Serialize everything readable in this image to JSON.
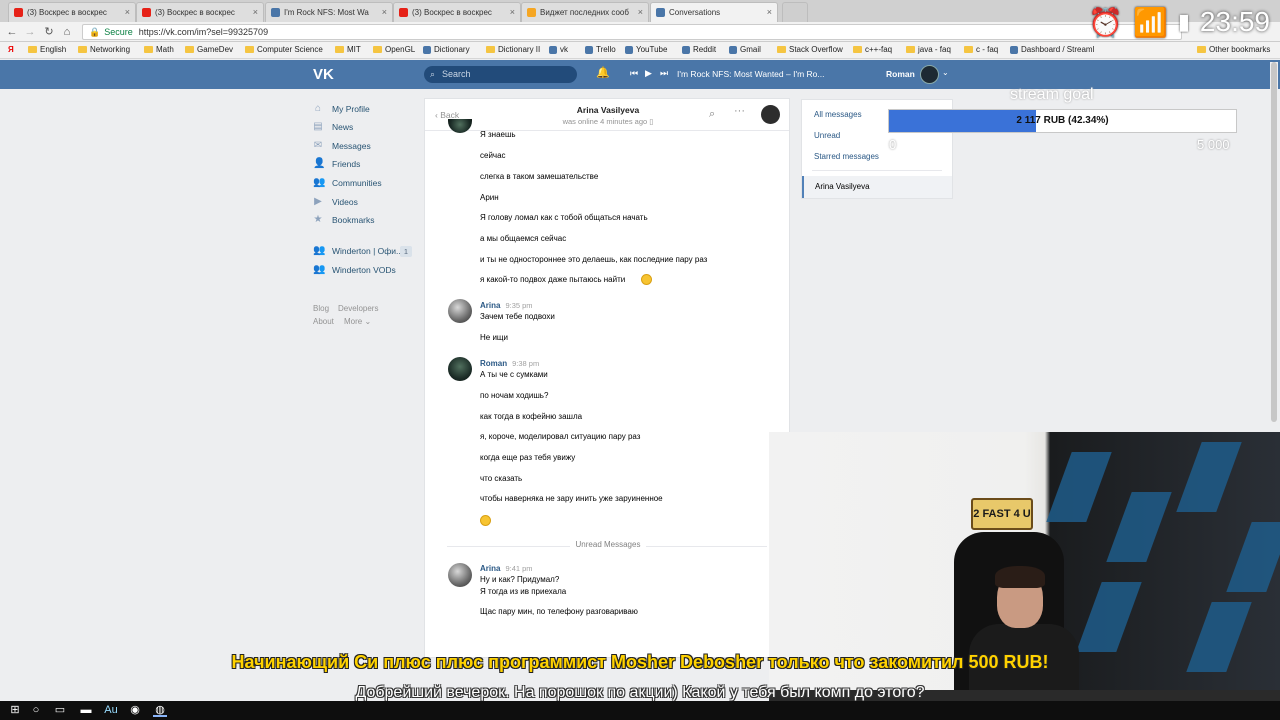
{
  "browser": {
    "tabs": [
      {
        "title": "(3) Воскрес в воскрес",
        "icon": "youtube-icon",
        "color": "#e62117",
        "active": false
      },
      {
        "title": "(3) Воскрес в воскрес",
        "icon": "youtube-icon",
        "color": "#e62117",
        "active": false
      },
      {
        "title": "I'm Rock NFS: Most Wa",
        "icon": "media-icon",
        "color": "#4a76a8",
        "active": false
      },
      {
        "title": "(3) Воскрес в воскрес",
        "icon": "youtube-icon",
        "color": "#e62117",
        "active": false
      },
      {
        "title": "Виджет последних сооб",
        "icon": "widget-icon",
        "color": "#f5a623",
        "active": false
      },
      {
        "title": "Conversations",
        "icon": "vk-icon",
        "color": "#4a76a8",
        "active": true
      }
    ],
    "url_secure_label": "Secure",
    "url": "https://vk.com/im?sel=99325709",
    "bookmarks": [
      {
        "label": "English",
        "type": "folder"
      },
      {
        "label": "Networking",
        "type": "folder"
      },
      {
        "label": "Math",
        "type": "folder"
      },
      {
        "label": "GameDev",
        "type": "folder"
      },
      {
        "label": "Computer Science",
        "type": "folder"
      },
      {
        "label": "MIT",
        "type": "folder"
      },
      {
        "label": "OpenGL",
        "type": "folder"
      },
      {
        "label": "Dictionary",
        "type": "site"
      },
      {
        "label": "Dictionary II",
        "type": "folder"
      },
      {
        "label": "vk",
        "type": "site"
      },
      {
        "label": "Trello",
        "type": "site"
      },
      {
        "label": "YouTube",
        "type": "site"
      },
      {
        "label": "Reddit",
        "type": "site"
      },
      {
        "label": "Gmail",
        "type": "site"
      },
      {
        "label": "Stack Overflow",
        "type": "folder"
      },
      {
        "label": "c++-faq",
        "type": "folder"
      },
      {
        "label": "java - faq",
        "type": "folder"
      },
      {
        "label": "c - faq",
        "type": "folder"
      },
      {
        "label": "Dashboard / Streaml",
        "type": "site"
      }
    ],
    "other_bookmarks": "Other bookmarks",
    "overlay_clock": "23:59",
    "overlay_small_label": "Winderton"
  },
  "vk": {
    "logo": "VK",
    "search_placeholder": "Search",
    "player_track": "I'm Rock NFS: Most Wanted – I'm Ro...",
    "user_name": "Roman",
    "nav": [
      {
        "label": "My Profile",
        "icon": "home-icon",
        "glyph": "⌂"
      },
      {
        "label": "News",
        "icon": "news-icon",
        "glyph": "▤"
      },
      {
        "label": "Messages",
        "icon": "messages-icon",
        "glyph": "✉"
      },
      {
        "label": "Friends",
        "icon": "friends-icon",
        "glyph": "👤"
      },
      {
        "label": "Communities",
        "icon": "communities-icon",
        "glyph": "👥"
      },
      {
        "label": "Videos",
        "icon": "videos-icon",
        "glyph": "▶"
      },
      {
        "label": "Bookmarks",
        "icon": "star-icon",
        "glyph": "★"
      }
    ],
    "groups": [
      {
        "label": "Winderton | Офи...",
        "count": "1"
      },
      {
        "label": "Winderton VODs",
        "count": ""
      }
    ],
    "footer": [
      "Blog",
      "Developers",
      "About",
      "More ⌄"
    ],
    "chat": {
      "back_label": "Back",
      "name": "Arina Vasilyeva",
      "status": "was online 4 minutes ago",
      "messages_top": [
        "Я знаешь",
        "сейчас",
        "слегка в таком замешательстве",
        "Арин",
        "Я голову ломал как с тобой общаться начать",
        "а мы общаемся сейчас",
        "и ты не одностороннее это делаешь, как последние пару раз",
        "я какой-то подвох даже пытаюсь найти"
      ],
      "arina_block1": {
        "author": "Arina",
        "time": "9:35 pm",
        "lines": [
          "Зачем тебе подвохи",
          "Не ищи"
        ]
      },
      "roman_block": {
        "author": "Roman",
        "time": "9:38 pm",
        "lines": [
          "А ты че с сумками",
          "по ночам ходишь?",
          "как тогда в кофейню зашла",
          "я, короче, моделировал ситуацию пару раз",
          "когда еще раз тебя увижу",
          "что сказать",
          "чтобы наверняка не зару инить уже заруиненное"
        ]
      },
      "unread_label": "Unread Messages",
      "arina_block2": {
        "author": "Arina",
        "time": "9:41 pm",
        "lines": [
          "Ну и как? Придумал?",
          "Я тогда из ив приехала",
          "Щас пару мин, по телефону разговариваю"
        ]
      }
    },
    "filters": {
      "items": [
        "All messages",
        "Unread",
        "Starred messages"
      ],
      "active_conversation": "Arina Vasilyeva"
    }
  },
  "stream_goal": {
    "title": "stream goal",
    "progress_text": "2 117 RUB (42.34%)",
    "progress_fraction": 0.4234,
    "min_label": "0",
    "max_label": "5 000",
    "fill_color": "#3a72d8"
  },
  "webcam": {
    "plate_text": "2 FAST 4 U"
  },
  "donation": {
    "headline": "Начинающий Си плюс плюс программист Mosher Debosher только что закомитил 500 RUB!",
    "message": "Добрейший вечерок. На порошок по акции) Какой у тебя был комп до этого?"
  }
}
